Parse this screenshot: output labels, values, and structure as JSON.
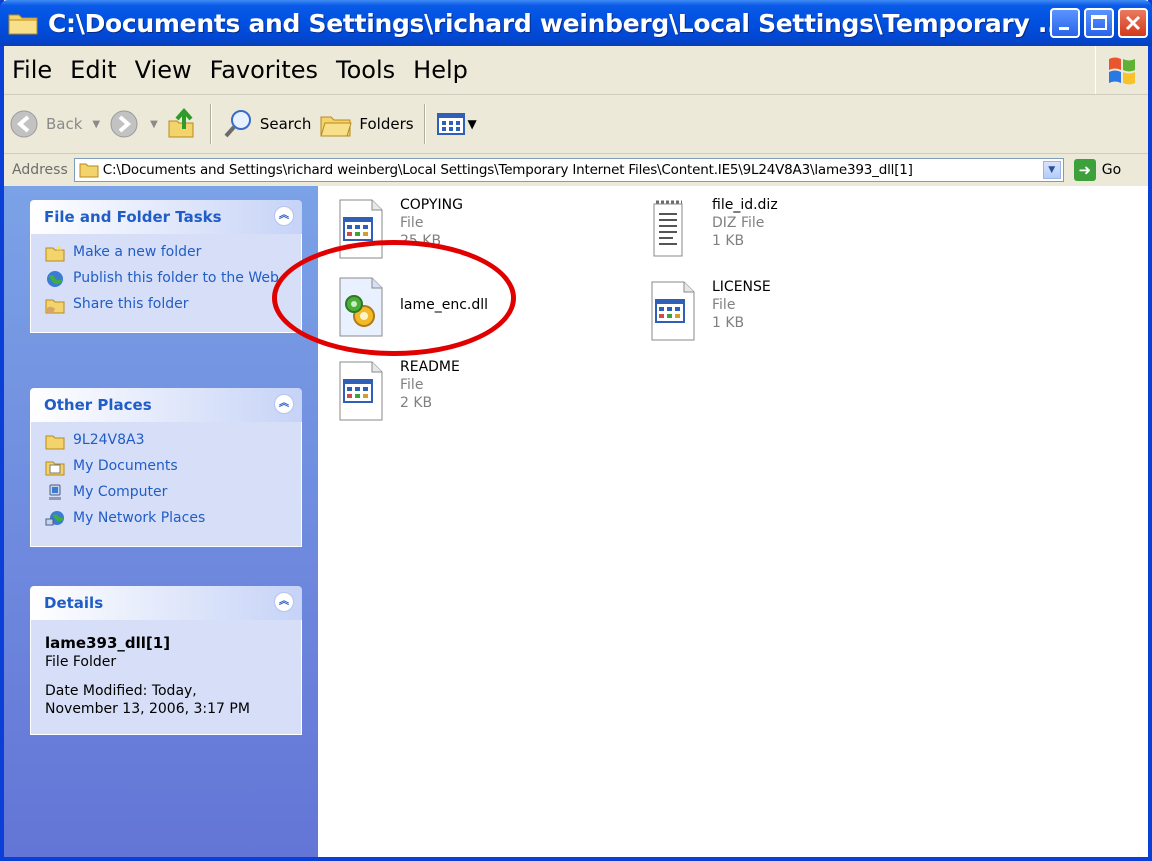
{
  "window": {
    "title": "C:\\Documents and Settings\\richard weinberg\\Local Settings\\Temporary ..."
  },
  "menu": {
    "items": [
      "File",
      "Edit",
      "View",
      "Favorites",
      "Tools",
      "Help"
    ]
  },
  "toolbar": {
    "back_label": "Back",
    "search_label": "Search",
    "folders_label": "Folders"
  },
  "address": {
    "label": "Address",
    "value": "C:\\Documents and Settings\\richard weinberg\\Local Settings\\Temporary Internet Files\\Content.IE5\\9L24V8A3\\lame393_dll[1]",
    "go_label": "Go"
  },
  "sidebar": {
    "file_tasks": {
      "title": "File and Folder Tasks",
      "items": [
        "Make a new folder",
        "Publish this folder to the Web",
        "Share this folder"
      ]
    },
    "other_places": {
      "title": "Other Places",
      "items": [
        "9L24V8A3",
        "My Documents",
        "My Computer",
        "My Network Places"
      ]
    },
    "details": {
      "title": "Details",
      "name": "lame393_dll[1]",
      "type": "File Folder",
      "date_line1": "Date Modified: Today,",
      "date_line2": "November 13, 2006, 3:17 PM"
    }
  },
  "files": [
    {
      "name": "COPYING",
      "type": "File",
      "size": "25 KB"
    },
    {
      "name": "file_id.diz",
      "type": "DIZ File",
      "size": "1 KB"
    },
    {
      "name": "lame_enc.dll",
      "type": "",
      "size": ""
    },
    {
      "name": "LICENSE",
      "type": "File",
      "size": "1 KB"
    },
    {
      "name": "README",
      "type": "File",
      "size": "2 KB"
    }
  ],
  "colors": {
    "titlebar": "#0050e0",
    "sidebar_gradient_top": "#7ba2e7",
    "link": "#215dc6",
    "highlight_ellipse": "#e00000"
  }
}
